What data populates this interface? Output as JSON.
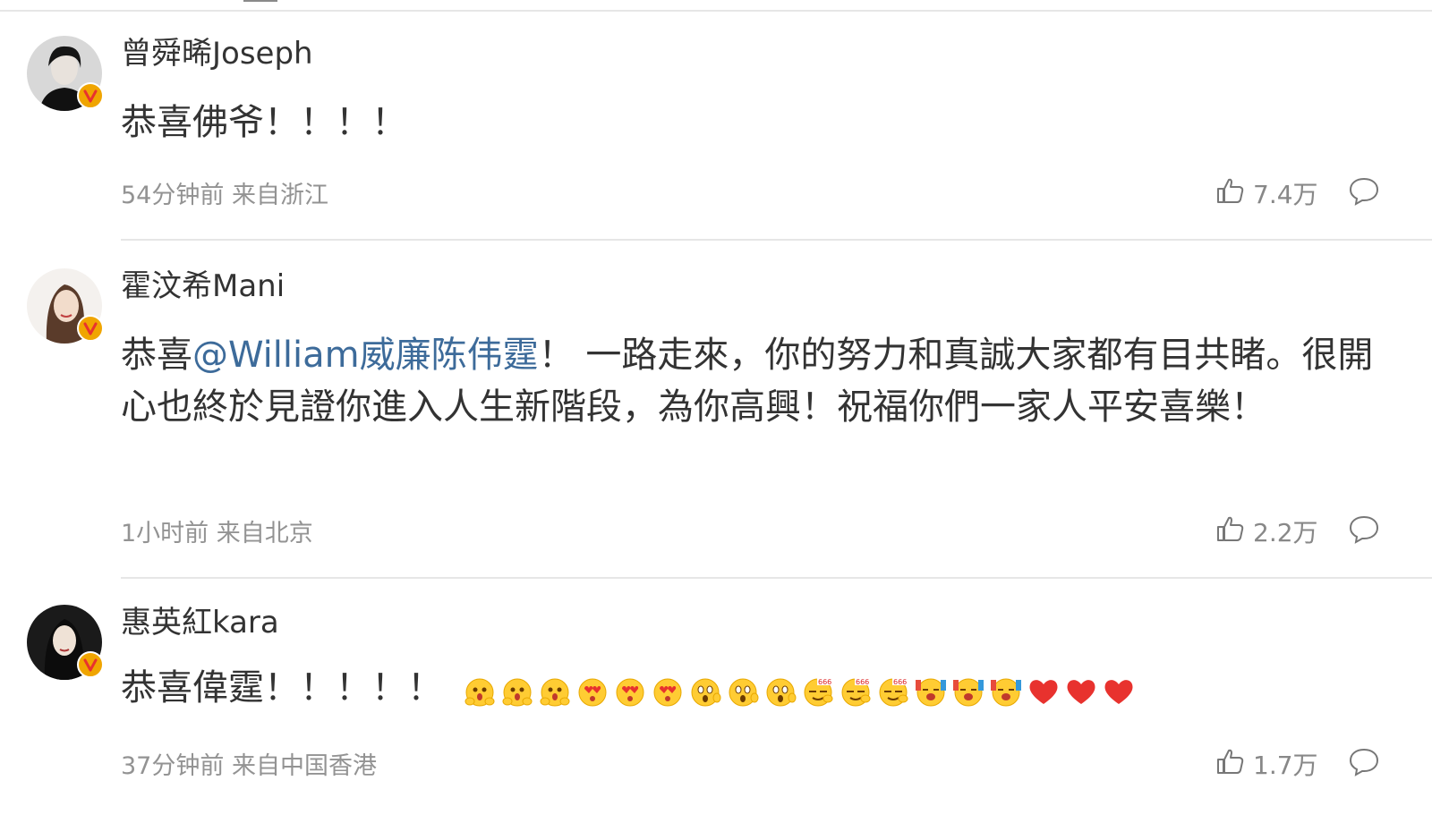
{
  "comments": [
    {
      "username": "曾舜晞Joseph",
      "text": "恭喜佛爷！！！！",
      "time": "54分钟前",
      "location": "来自浙江",
      "likes": "7.4万"
    },
    {
      "username": "霍汶希Mani",
      "text_before": "恭喜",
      "mention": "@William威廉陈伟霆",
      "text_after": "！ 一路走來，你的努力和真誠大家都有目共睹。很開心也終於見證你進入人生新階段，為你高興！祝福你們一家人平安喜樂！",
      "time": "1小时前",
      "location": "来自北京",
      "likes": "2.2万"
    },
    {
      "username": "惠英紅kara",
      "text": "恭喜偉霆！！！！！",
      "time": "37分钟前",
      "location": "来自中国香港",
      "likes": "1.7万",
      "emojis": [
        "hug",
        "hug",
        "hug",
        "heart-eyes",
        "heart-eyes",
        "heart-eyes",
        "surprised",
        "surprised",
        "surprised",
        "666",
        "666",
        "666",
        "cheer",
        "cheer",
        "cheer",
        "red-heart",
        "red-heart",
        "red-heart"
      ]
    }
  ],
  "icons": {
    "like": "thumbs-up-icon",
    "reply": "comment-bubble-icon",
    "verified": "verified-v-badge-icon"
  },
  "colors": {
    "mention": "#3d6b9a",
    "meta": "#939393",
    "badge": "#f0a500",
    "heart": "#e8322e"
  }
}
